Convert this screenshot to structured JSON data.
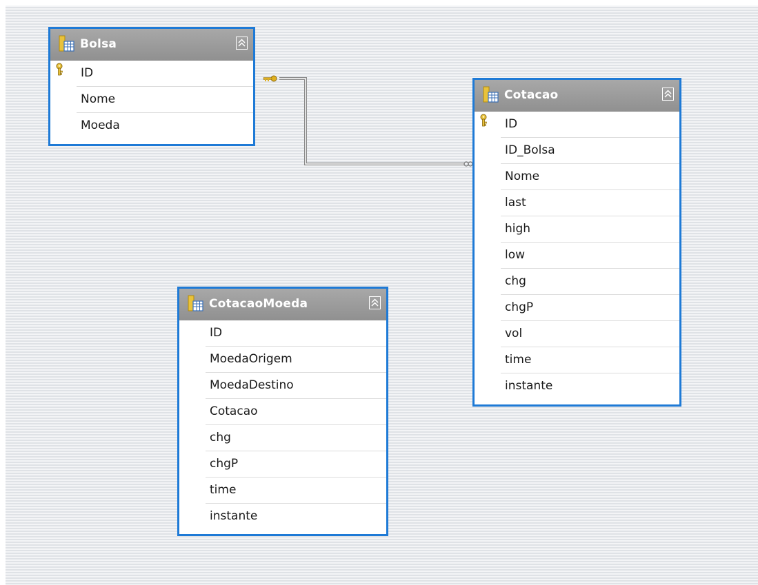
{
  "tables": {
    "bolsa": {
      "title": "Bolsa",
      "columns": [
        "ID",
        "Nome",
        "Moeda"
      ],
      "primary_key": "ID"
    },
    "cotacao": {
      "title": "Cotacao",
      "columns": [
        "ID",
        "ID_Bolsa",
        "Nome",
        "last",
        "high",
        "low",
        "chg",
        "chgP",
        "vol",
        "time",
        "instante"
      ],
      "primary_key": "ID"
    },
    "cotacaomoeda": {
      "title": "CotacaoMoeda",
      "columns": [
        "ID",
        "MoedaOrigem",
        "MoedaDestino",
        "Cotacao",
        "chg",
        "chgP",
        "time",
        "instante"
      ],
      "primary_key": ""
    }
  },
  "relationship": {
    "from_table": "Bolsa",
    "from_column": "ID",
    "to_table": "Cotacao",
    "to_column": "ID_Bolsa",
    "from_end_icon": "key-icon",
    "to_end_icon": "infinity-icon"
  },
  "colors": {
    "table_border": "#1e7ad6",
    "header_bg": "#9c9c9c",
    "header_text": "#ffffff",
    "relationship_line": "#8a8a8a"
  },
  "icons": {
    "table": "table-icon",
    "collapse": "collapse-up-icon",
    "primary_key": "key-icon"
  }
}
